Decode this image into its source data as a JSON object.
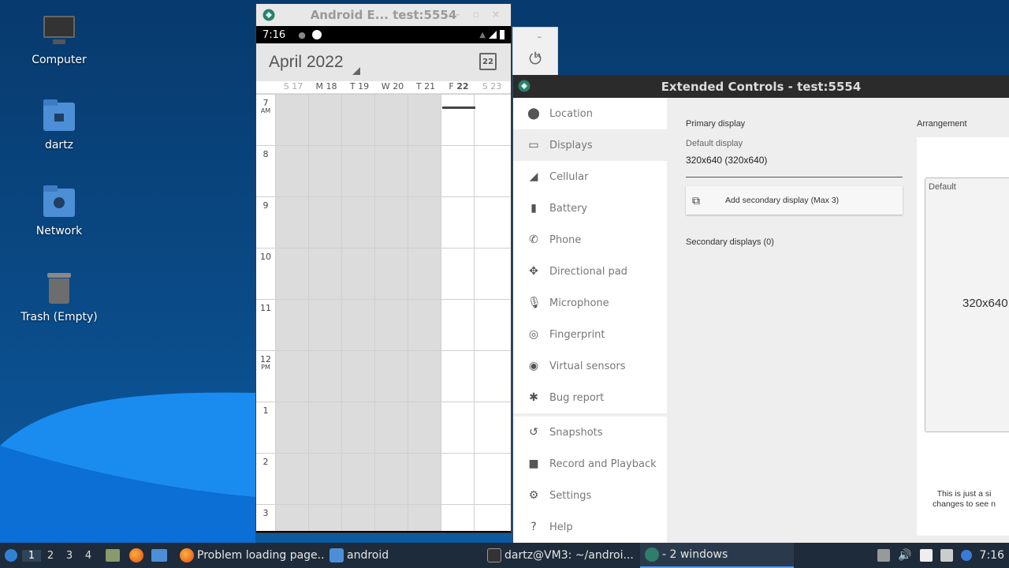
{
  "desktop": {
    "icons": [
      {
        "label": "Computer"
      },
      {
        "label": "dartz"
      },
      {
        "label": "Network"
      },
      {
        "label": "Trash (Empty)"
      }
    ],
    "colors": {
      "background": "#0a4a86",
      "wave": "#1a8cf0"
    }
  },
  "emulator": {
    "title": "Android E... test:5554",
    "status_time": "7:16",
    "calendar": {
      "month": "April 2022",
      "today_number": "22",
      "days": [
        {
          "dow": "S",
          "num": "17"
        },
        {
          "dow": "M",
          "num": "18"
        },
        {
          "dow": "T",
          "num": "19"
        },
        {
          "dow": "W",
          "num": "20"
        },
        {
          "dow": "T",
          "num": "21"
        },
        {
          "dow": "F",
          "num": "22"
        },
        {
          "dow": "S",
          "num": "23"
        }
      ],
      "hours": [
        {
          "h": "7",
          "ampm": "AM"
        },
        {
          "h": "8",
          "ampm": ""
        },
        {
          "h": "9",
          "ampm": ""
        },
        {
          "h": "10",
          "ampm": ""
        },
        {
          "h": "11",
          "ampm": ""
        },
        {
          "h": "12",
          "ampm": "PM"
        },
        {
          "h": "1",
          "ampm": ""
        },
        {
          "h": "2",
          "ampm": ""
        },
        {
          "h": "3",
          "ampm": ""
        }
      ]
    }
  },
  "power_window": {
    "controls": "– ×",
    "power_icon": "power-icon"
  },
  "extended_controls": {
    "title": "Extended Controls - test:5554",
    "nav": [
      {
        "label": "Location",
        "icon": "location-pin-icon"
      },
      {
        "label": "Displays",
        "icon": "display-icon"
      },
      {
        "label": "Cellular",
        "icon": "signal-icon"
      },
      {
        "label": "Battery",
        "icon": "battery-icon"
      },
      {
        "label": "Phone",
        "icon": "phone-icon"
      },
      {
        "label": "Directional pad",
        "icon": "dpad-icon"
      },
      {
        "label": "Microphone",
        "icon": "microphone-icon"
      },
      {
        "label": "Fingerprint",
        "icon": "fingerprint-icon"
      },
      {
        "label": "Virtual sensors",
        "icon": "sensors-icon"
      },
      {
        "label": "Bug report",
        "icon": "bug-icon"
      },
      {
        "label": "Snapshots",
        "icon": "history-icon"
      },
      {
        "label": "Record and Playback",
        "icon": "camera-icon"
      },
      {
        "label": "Settings",
        "icon": "gear-icon"
      },
      {
        "label": "Help",
        "icon": "help-icon"
      }
    ],
    "active_nav": "Displays",
    "primary_display_heading": "Primary display",
    "default_display_label": "Default display",
    "default_display_value": "320x640 (320x640)",
    "add_secondary_label": "Add secondary display (Max 3)",
    "secondary_heading": "Secondary displays (0)",
    "arrangement_heading": "Arrangement",
    "arrangement_box_label": "Default",
    "arrangement_box_resolution": "320x640",
    "arrangement_note_line1": "This is just a si",
    "arrangement_note_line2": "changes to see n"
  },
  "taskbar": {
    "workspaces": [
      "1",
      "2",
      "3",
      "4"
    ],
    "active_workspace": "1",
    "tasks": [
      {
        "label": "Problem loading page...",
        "icon": "firefox-icon"
      },
      {
        "label": "android",
        "icon": "folder-icon"
      },
      {
        "label": "dartz@VM3: ~/androi...",
        "icon": "terminal-icon"
      },
      {
        "label": "- 2 windows",
        "icon": "emulator-icon"
      }
    ],
    "clock": "7:16"
  }
}
